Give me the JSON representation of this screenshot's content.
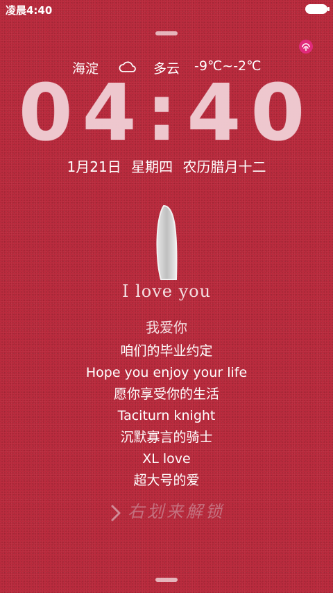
{
  "status_bar": {
    "time": "凌晨4:40",
    "battery_icon": "battery-full-icon"
  },
  "theme_icon": "fingerprint-icon",
  "weather": {
    "city": "海淀",
    "condition_icon": "cloud-icon",
    "condition": "多云",
    "temperature": "-9℃~-2℃"
  },
  "clock": {
    "time": "04:40"
  },
  "date": {
    "month_day": "1月21日",
    "weekday": "星期四",
    "lunar": "农历腊月十二"
  },
  "graphic": {
    "icon": "love-sticker-icon",
    "caption": "I love you"
  },
  "message_lines": [
    "我爱你",
    "咱们的毕业约定",
    "Hope you enjoy your life",
    "愿你享受你的生活",
    "Taciturn knight",
    "沉默寡言的骑士",
    "XL love",
    "超大号的爱"
  ],
  "unlock": {
    "icon": "chevron-right-icon",
    "label": "右划来解锁"
  },
  "colors": {
    "background": "#b8273a",
    "text": "#ffffff",
    "clock": "#f0cdd4",
    "accent_icon": "#e02a7a"
  }
}
